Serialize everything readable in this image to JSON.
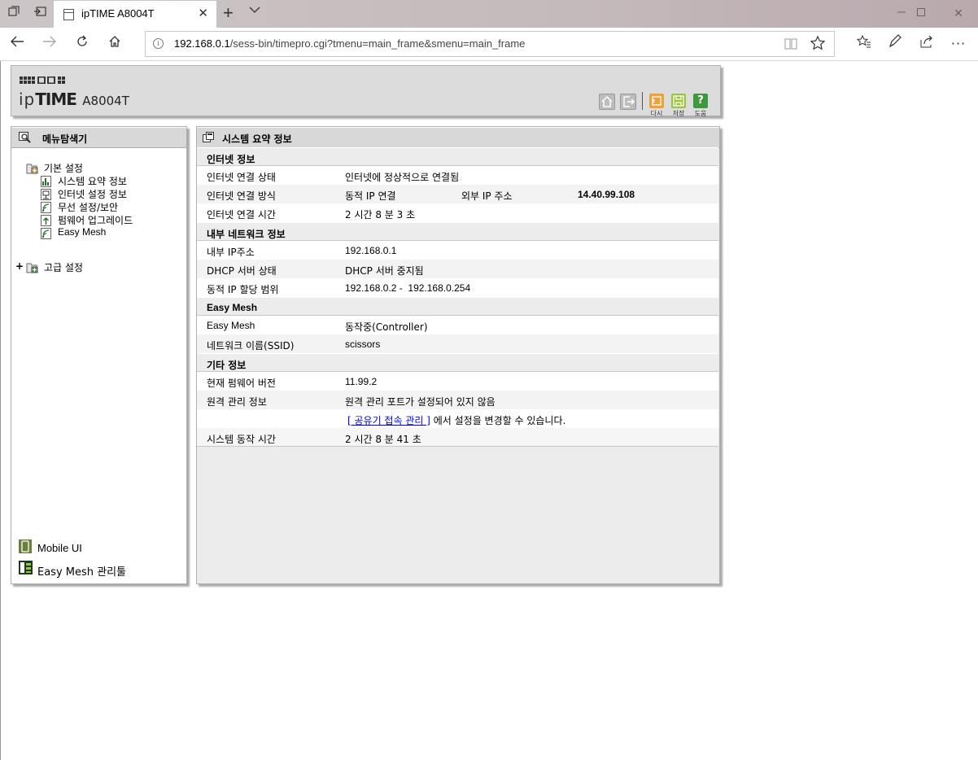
{
  "browser": {
    "tab_title": "ipTIME A8004T",
    "new_tab_icon": "plus-icon",
    "url_host": "192.168.0.1",
    "url_path": "/sess-bin/timepro.cgi?tmenu=main_frame&smenu=main_frame"
  },
  "header": {
    "logo_prefix": "ip",
    "logo_brand": "TIME",
    "model": "A8004T",
    "buttons": [
      {
        "label": "다시",
        "color": "#e8a33a"
      },
      {
        "label": "저장",
        "color": "#9cc43c"
      },
      {
        "label": "도움",
        "color": "#3c9a3c"
      }
    ]
  },
  "left_panel": {
    "title": "메뉴탐색기",
    "basic": {
      "label": "기본 설정",
      "items": [
        "시스템 요약 정보",
        "인터넷 설정 정보",
        "무선 설정/보안",
        "펌웨어 업그레이드",
        "Easy Mesh"
      ]
    },
    "advanced": {
      "expander": "+",
      "label": "고급 설정"
    },
    "bottom": [
      "Mobile UI",
      "Easy Mesh 관리툴"
    ]
  },
  "main_panel": {
    "title": "시스템 요약 정보",
    "sections": [
      {
        "title": "인터넷 정보",
        "rows": [
          {
            "label": "인터넷 연결 상태",
            "value": "인터넷에 정상적으로 연결됨"
          },
          {
            "label": "인터넷 연결 방식",
            "value": "동적 IP 연결",
            "extra_label": "외부 IP 주소",
            "extra_value": "14.40.99.108"
          },
          {
            "label": "인터넷 연결 시간",
            "value": "2 시간 8 분 3 초"
          }
        ]
      },
      {
        "title": "내부 네트워크 정보",
        "rows": [
          {
            "label": "내부 IP주소",
            "value": "192.168.0.1"
          },
          {
            "label": "DHCP 서버 상태",
            "value": "DHCP 서버 중지됨"
          },
          {
            "label": "동적 IP 할당 범위",
            "value": "192.168.0.2 -  192.168.0.254"
          }
        ]
      },
      {
        "title": "Easy Mesh",
        "rows": [
          {
            "label": "Easy Mesh",
            "value": "동작중(Controller)"
          },
          {
            "label": "네트워크 이름(SSID)",
            "value": "scissors"
          }
        ]
      },
      {
        "title": "기타 정보",
        "rows": [
          {
            "label": "현재 펌웨어 버전",
            "value": "11.99.2"
          },
          {
            "label": "원격 관리 정보",
            "value": "원격 관리 포트가 설정되어 있지 않음"
          },
          {
            "label": "",
            "link": "[ 공유기 접속 관리 ]",
            "value_after_link": " 에서 설정을 변경할 수 있습니다."
          },
          {
            "label": "시스템 동작 시간",
            "value": "2 시간 8 분 41 초"
          }
        ]
      }
    ]
  }
}
